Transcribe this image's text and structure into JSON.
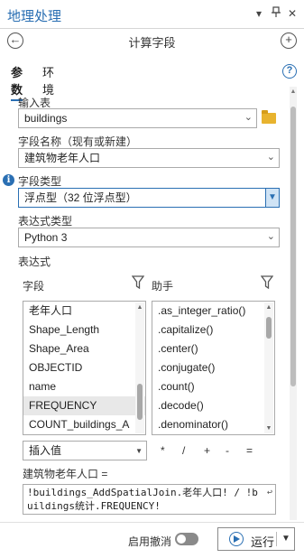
{
  "window": {
    "title": "地理处理",
    "controls": {
      "dropdown": "▾",
      "pin": "📌",
      "close": "✕"
    }
  },
  "nav": {
    "title": "计算字段",
    "back_icon": "arrow-left-icon",
    "add_icon": "plus-icon"
  },
  "tabs": [
    {
      "label": "参数",
      "active": true
    },
    {
      "label": "环境",
      "active": false
    }
  ],
  "help": "?",
  "form": {
    "input_table": {
      "label": "输入表",
      "value": "buildings"
    },
    "field_name": {
      "label": "字段名称（现有或新建）",
      "value": "建筑物老年人口"
    },
    "field_type": {
      "label": "字段类型",
      "value": "浮点型（32 位浮点型）"
    },
    "expression_type": {
      "label": "表达式类型",
      "value": "Python 3"
    },
    "expression": {
      "label": "表达式"
    }
  },
  "fields_panel": {
    "header": "字段",
    "items": [
      "老年人口",
      "Shape_Length",
      "Shape_Area",
      "OBJECTID",
      "name",
      "FREQUENCY",
      "COUNT_buildings_A"
    ],
    "selected": "FREQUENCY"
  },
  "helpers_panel": {
    "header": "助手",
    "items": [
      ".as_integer_ratio()",
      ".capitalize()",
      ".center()",
      ".conjugate()",
      ".count()",
      ".decode()",
      ".denominator()"
    ]
  },
  "insert": {
    "value": "插入值"
  },
  "operators": [
    "*",
    "/",
    "+",
    "-",
    "="
  ],
  "expression_editor": {
    "label": "建筑物老年人口 =",
    "code": "!buildings_AddSpatialJoin.老年人口! / !buildings统计.FREQUENCY!"
  },
  "footer": {
    "undo_label": "启用撤消",
    "undo_enabled": false,
    "run_label": "运行"
  },
  "colors": {
    "accent": "#2a6fb3",
    "folder": "#e8b32e"
  }
}
